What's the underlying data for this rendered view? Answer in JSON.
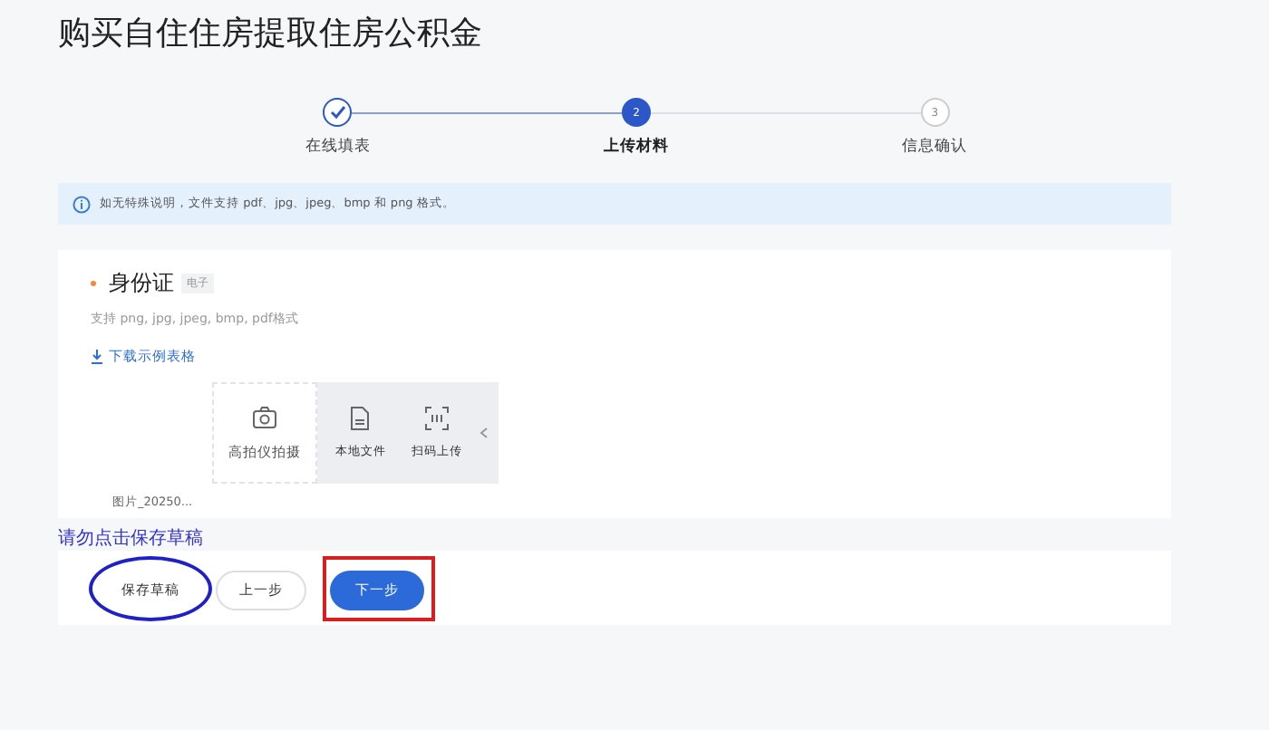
{
  "title": "购买自住住房提取住房公积金",
  "steps": [
    {
      "label": "在线填表",
      "done": true,
      "selected": false
    },
    {
      "label": "上传材料",
      "number": "2",
      "done": false,
      "selected": true
    },
    {
      "label": "信息确认",
      "number": "3",
      "done": false,
      "selected": false
    }
  ],
  "notice": "如无特殊说明，文件支持 pdf、jpg、jpeg、bmp 和 png 格式。",
  "upload": {
    "required": true,
    "label": "身份证",
    "tag": "电子",
    "hint": "支持 png, jpg, jpeg, bmp, pdf格式",
    "download_link": "下载示例表格",
    "options": [
      {
        "kind": "camera",
        "label": "高拍仪拍摄"
      },
      {
        "kind": "file",
        "label": "本地文件"
      },
      {
        "kind": "scan",
        "label": "扫码上传"
      }
    ],
    "file_name": "图片_20250..."
  },
  "annotation": "请勿点击保存草稿",
  "buttons": [
    {
      "label": "保存草稿",
      "kind": "plain",
      "circled": true,
      "boxed": false
    },
    {
      "label": "上一步",
      "kind": "outline",
      "circled": false,
      "boxed": false
    },
    {
      "label": "下一步",
      "kind": "primary",
      "circled": false,
      "boxed": true
    }
  ]
}
